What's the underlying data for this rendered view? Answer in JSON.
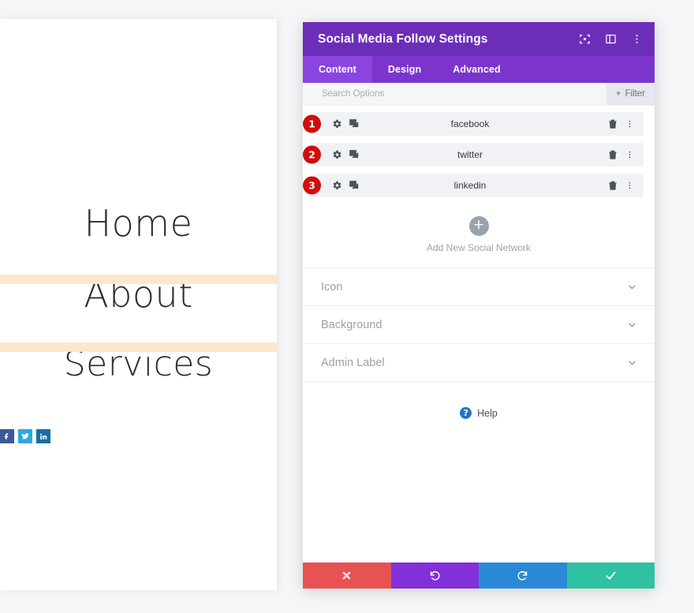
{
  "preview": {
    "menu_items": [
      {
        "label": "Home"
      },
      {
        "label": "About"
      },
      {
        "label": "Services"
      }
    ],
    "social_icons": [
      {
        "name": "facebook",
        "glyph": "f",
        "color": "#3b5998"
      },
      {
        "name": "twitter",
        "glyph": "t",
        "color": "#2ca8e0"
      },
      {
        "name": "linkedin",
        "glyph": "in",
        "color": "#1a6ca4"
      }
    ],
    "divider_color": "#fae8c8"
  },
  "modal": {
    "title": "Social Media Follow Settings",
    "header_icons": [
      {
        "name": "focus-icon"
      },
      {
        "name": "layout-panel-icon"
      },
      {
        "name": "more-vertical-icon"
      }
    ],
    "tabs": [
      {
        "label": "Content",
        "active": true
      },
      {
        "label": "Design",
        "active": false
      },
      {
        "label": "Advanced",
        "active": false
      }
    ],
    "search": {
      "placeholder": "Search Options",
      "value": "",
      "filter_label": "Filter",
      "filter_icon": "plus-icon"
    },
    "networks": [
      {
        "number": "1",
        "label": "facebook"
      },
      {
        "number": "2",
        "label": "twitter"
      },
      {
        "number": "3",
        "label": "linkedin"
      }
    ],
    "row_icons": {
      "settings": "gear-icon",
      "duplicate": "duplicate-icon",
      "delete": "trash-icon",
      "menu": "more-vertical-icon"
    },
    "add_new": {
      "label": "Add New Social Network",
      "icon": "plus-icon"
    },
    "accordions": [
      {
        "label": "Icon"
      },
      {
        "label": "Background"
      },
      {
        "label": "Admin Label"
      }
    ],
    "help": {
      "label": "Help",
      "icon_glyph": "?"
    },
    "actions": [
      {
        "name": "cancel",
        "icon": "close-icon",
        "color": "#e75253"
      },
      {
        "name": "undo",
        "icon": "undo-icon",
        "color": "#8330da"
      },
      {
        "name": "redo",
        "icon": "redo-icon",
        "color": "#2a89d5"
      },
      {
        "name": "save",
        "icon": "checkmark-icon",
        "color": "#2ec2a2"
      }
    ],
    "accent_colors": {
      "header": "#6c2eb9",
      "tabbar": "#7c34cf",
      "tab_active": "#8c44e0",
      "badge": "#d10d0d"
    }
  }
}
